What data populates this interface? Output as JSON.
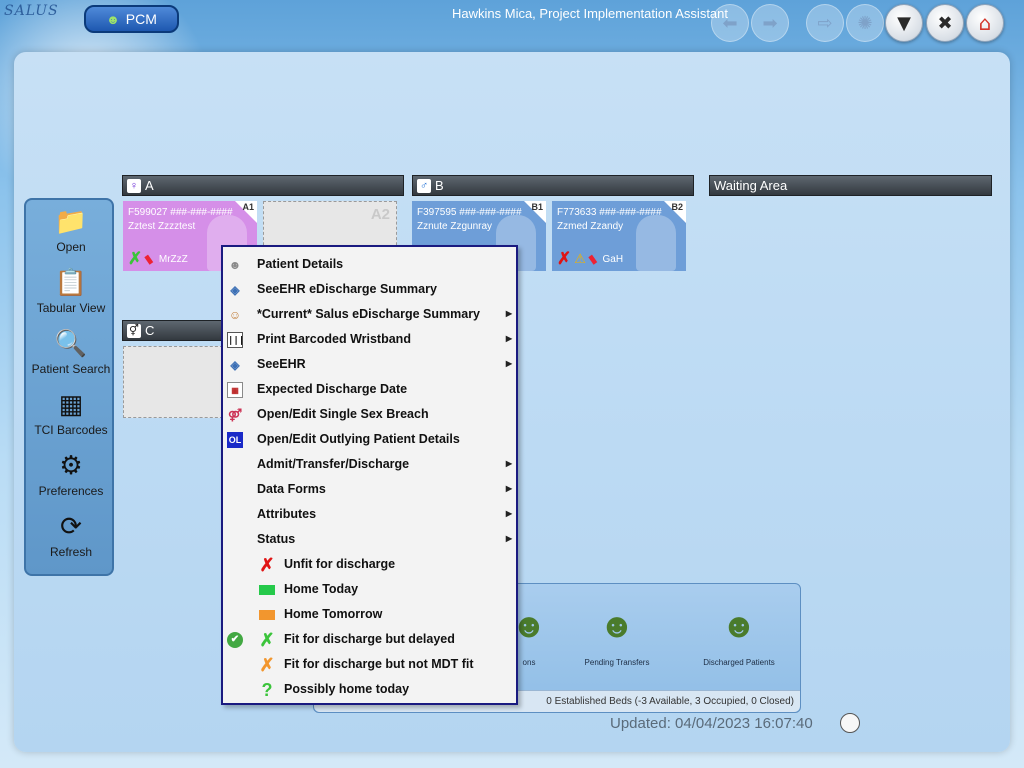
{
  "app": {
    "logo_text": "SALUS",
    "module_label": "PCM",
    "user_title": "Hawkins Mica, Project Implementation Assistant"
  },
  "toolbar": {
    "back_icon": "arrow-left-icon",
    "forward_icon": "arrow-right-icon",
    "exit_icon": "exit-icon",
    "network_icon": "network-icon",
    "filter_icon": "filter-icon",
    "close_icon": "close-icon",
    "home_icon": "home-icon"
  },
  "sidebar": {
    "items": [
      {
        "label": "Open",
        "icon": "folder-icon"
      },
      {
        "label": "Tabular View",
        "icon": "clipboard-icon"
      },
      {
        "label": "Patient Search",
        "icon": "search-icon"
      },
      {
        "label": "TCI Barcodes",
        "icon": "qr-code-icon"
      },
      {
        "label": "Preferences",
        "icon": "gear-icon"
      },
      {
        "label": "Refresh",
        "icon": "refresh-icon"
      }
    ]
  },
  "wards": [
    {
      "name": "A",
      "gender": "female"
    },
    {
      "name": "B",
      "gender": "male"
    },
    {
      "name": "Waiting Area"
    },
    {
      "name": "C",
      "gender": "mixed"
    }
  ],
  "beds": [
    {
      "id": "A1",
      "ref": "F599027  ###-###-####",
      "patient": "Zztest Zzzztest",
      "consultant": "MrZzZ",
      "gender": "female",
      "status": "fit-but-delayed",
      "alert": "medication"
    },
    {
      "id": "A2",
      "empty": true
    },
    {
      "id": "B1",
      "ref": "F397595  ###-###-####",
      "patient": "Zznute Zzgunray",
      "gender": "male"
    },
    {
      "id": "B2",
      "ref": "F773633  ###-###-####",
      "patient": "Zzmed Zzandy",
      "consultant": "GaH",
      "gender": "male",
      "status": "unfit",
      "alert": "warning-and-medication"
    }
  ],
  "context_menu": {
    "items": [
      {
        "label": "Patient Details",
        "icon": "person-icon",
        "submenu": false
      },
      {
        "label": "SeeEHR eDischarge Summary",
        "icon": "eye-icon",
        "submenu": false
      },
      {
        "label": "*Current* Salus eDischarge Summary",
        "icon": "user-doc-icon",
        "submenu": true
      },
      {
        "label": "Print Barcoded Wristband",
        "icon": "barcode-icon",
        "submenu": true
      },
      {
        "label": "SeeEHR",
        "icon": "eye-icon",
        "submenu": true
      },
      {
        "label": "Expected Discharge Date",
        "icon": "calendar-icon",
        "submenu": false
      },
      {
        "label": "Open/Edit Single Sex Breach",
        "icon": "breach-icon",
        "submenu": false
      },
      {
        "label": "Open/Edit Outlying Patient Details",
        "icon": "ol-icon",
        "icon_text": "OL",
        "submenu": false
      },
      {
        "label": "Admit/Transfer/Discharge",
        "submenu": true
      },
      {
        "label": "Data Forms",
        "submenu": true
      },
      {
        "label": "Attributes",
        "submenu": true
      },
      {
        "label": "Status",
        "submenu": true
      }
    ],
    "status_items": [
      {
        "label": "Unfit for discharge",
        "marker": "red-x",
        "color": "#e01414"
      },
      {
        "label": "Home Today",
        "marker": "green-block",
        "color": "#25c94a"
      },
      {
        "label": "Home Tomorrow",
        "marker": "orange-block",
        "color": "#f2962e"
      },
      {
        "label": "Fit for discharge but delayed",
        "marker": "green-x",
        "color": "#3bc43b",
        "checked": true
      },
      {
        "label": "Fit for discharge but not MDT fit",
        "marker": "orange-x",
        "color": "#f2962e"
      },
      {
        "label": "Possibly home today",
        "marker": "green-question",
        "color": "#3bc43b"
      }
    ]
  },
  "summary": {
    "items": [
      {
        "label": "ons",
        "icon": "people-icon"
      },
      {
        "label": "Pending Transfers",
        "icon": "people-transfer-icon"
      },
      {
        "label": "Discharged Patients",
        "icon": "people-discharge-icon"
      }
    ],
    "footer": "0 Established Beds (-3 Available, 3 Occupied, 0 Closed)"
  },
  "status_bar": {
    "updated": "Updated: 04/04/2023 16:07:40"
  },
  "colors": {
    "female_bed": "#d58fe8",
    "male_bed": "#6e9ed8",
    "menu_border": "#1a1a80"
  }
}
